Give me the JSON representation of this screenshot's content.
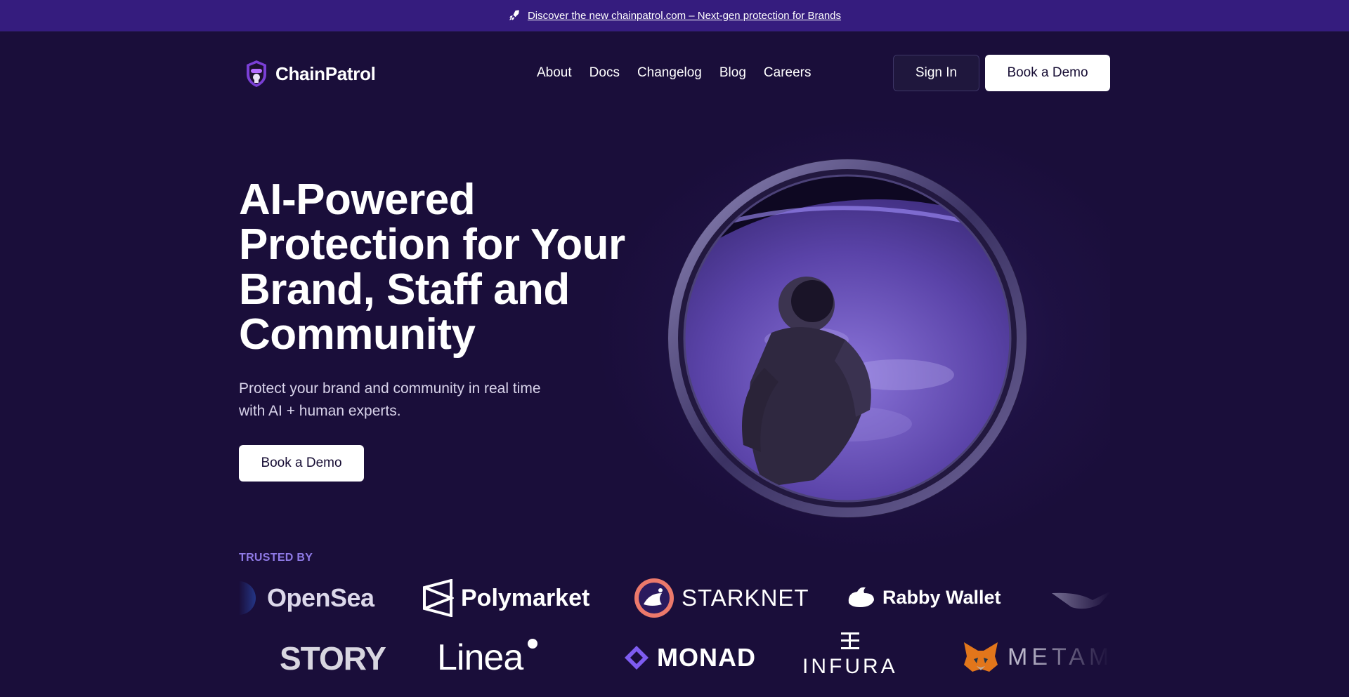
{
  "announcement": {
    "text": "Discover the new chainpatrol.com – Next-gen protection for Brands",
    "icon": "rocket-icon"
  },
  "brand": {
    "name": "ChainPatrol",
    "logo_icon": "shield-mascot-icon"
  },
  "nav": {
    "links": [
      "About",
      "Docs",
      "Changelog",
      "Blog",
      "Careers"
    ],
    "sign_in": "Sign In",
    "book_demo": "Book a Demo"
  },
  "hero": {
    "title_lines": [
      "AI-Powered",
      "Protection for Your",
      "Brand, Staff and",
      "Community"
    ],
    "subtitle_lines": [
      "Protect your brand and community in real time",
      "with AI + human experts."
    ],
    "cta": "Book a Demo"
  },
  "trusted": {
    "heading": "TRUSTED BY",
    "row1": [
      "OpenSea",
      "Polymarket",
      "STARKNET",
      "Rabby Wallet"
    ],
    "row2": [
      "STORY",
      "Linea",
      "MONAD",
      "INFURA",
      "METAMASK"
    ]
  },
  "colors": {
    "background": "#1a0e3a",
    "announcement_bar": "#351c7e",
    "accent": "#8f7ae6",
    "button_light": "#ffffff"
  }
}
